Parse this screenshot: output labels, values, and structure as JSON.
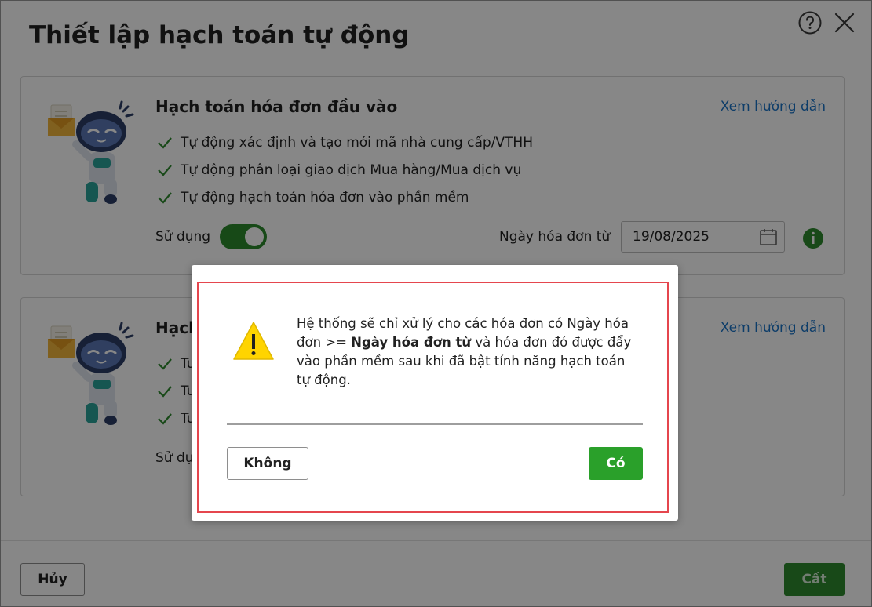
{
  "window": {
    "title": "Thiết lập hạch toán tự động",
    "help_icon": "help-circle-icon",
    "close_icon": "close-icon"
  },
  "cards": [
    {
      "title": "Hạch toán hóa đơn đầu vào",
      "guide_link": "Xem hướng dẫn",
      "features": [
        "Tự động xác định và tạo mới mã nhà cung cấp/VTHH",
        "Tự động phân loại giao dịch Mua hàng/Mua dịch vụ",
        "Tự động hạch toán hóa đơn vào phần mềm"
      ],
      "use_label": "Sử dụng",
      "toggle_on": true,
      "date_label": "Ngày hóa đơn từ",
      "date_value": "19/08/2025"
    },
    {
      "title": "Hạch",
      "guide_link": "Xem hướng dẫn",
      "features": [
        "Tu",
        "Tu",
        "Tu"
      ],
      "use_label": "Sử dụ"
    }
  ],
  "footer": {
    "cancel_label": "Hủy",
    "save_label": "Cất"
  },
  "dialog": {
    "message_prefix": "Hệ thống sẽ chỉ xử lý cho các hóa đơn có Ngày hóa đơn >= ",
    "message_bold": "Ngày hóa đơn từ",
    "message_suffix": " và hóa đơn đó được đẩy vào phần mềm sau khi đã bật tính năng hạch toán tự động.",
    "no_label": "Không",
    "yes_label": "Có"
  },
  "colors": {
    "primary_green": "#2f8a2f",
    "link_blue": "#1a73c7",
    "highlight_red": "#e5464e",
    "warning_yellow": "#ffd400"
  }
}
